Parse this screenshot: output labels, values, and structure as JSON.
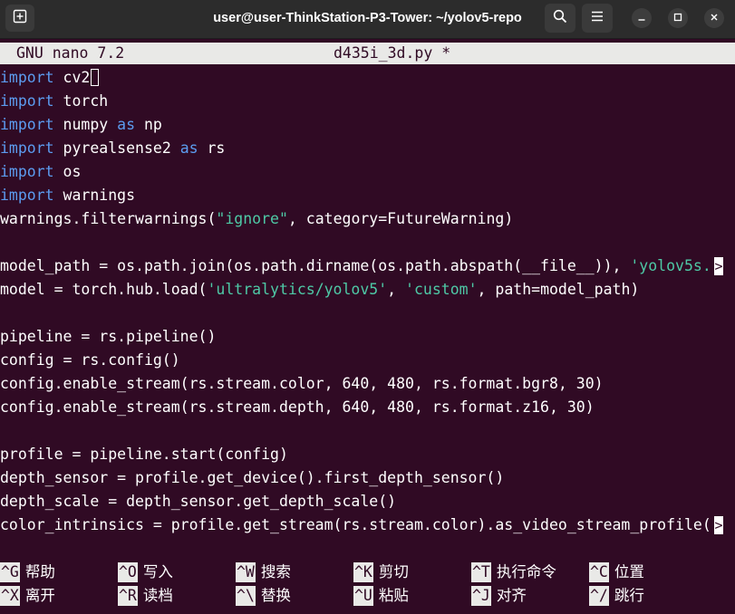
{
  "window": {
    "title": "user@user-ThinkStation-P3-Tower: ~/yolov5-repo"
  },
  "icons": {
    "new_tab": "new-tab-icon",
    "search": "search-icon",
    "menu": "hamburger-menu-icon",
    "minimize": "minimize-icon",
    "maximize": "maximize-icon",
    "close": "close-icon"
  },
  "colors": {
    "terminal_bg": "#300a24",
    "keyword": "#5c9cf0",
    "string": "#4ec9a6",
    "header_bg": "#e9e9e7"
  },
  "nano": {
    "version": "GNU nano 7.2",
    "filename": "d435i_3d.py *"
  },
  "code": {
    "l1": {
      "kw": "import",
      "rest": " cv2"
    },
    "l2": {
      "kw": "import",
      "rest": " torch"
    },
    "l3": {
      "kw1": "import",
      "a": " numpy ",
      "kw2": "as",
      "b": " np"
    },
    "l4": {
      "kw1": "import",
      "a": " pyrealsense2 ",
      "kw2": "as",
      "b": " rs"
    },
    "l5": {
      "kw": "import",
      "rest": " os"
    },
    "l6": {
      "kw": "import",
      "rest": " warnings"
    },
    "l7": {
      "a": "warnings.filterwarnings(",
      "s1": "\"ignore\"",
      "b": ", category=FutureWarning)"
    },
    "l9": {
      "a": "model_path = os.path.join(os.path.dirname(os.path.abspath(__file__)), ",
      "s1": "'yolov5s.",
      "marker": ">"
    },
    "l10": {
      "a": "model = torch.hub.load(",
      "s1": "'ultralytics/yolov5'",
      "b": ", ",
      "s2": "'custom'",
      "c": ", path=model_path)"
    },
    "l12": "pipeline = rs.pipeline()",
    "l13": "config = rs.config()",
    "l14": "config.enable_stream(rs.stream.color, 640, 480, rs.format.bgr8, 30)",
    "l15": "config.enable_stream(rs.stream.depth, 640, 480, rs.format.z16, 30)",
    "l17": "profile = pipeline.start(config)",
    "l18": "depth_sensor = profile.get_device().first_depth_sensor()",
    "l19": "depth_scale = depth_sensor.get_depth_scale()",
    "l20": {
      "a": "color_intrinsics = profile.get_stream(rs.stream.color).as_video_stream_profile(",
      "marker": ">"
    }
  },
  "shortcuts": [
    {
      "key": "^G",
      "label": "帮助"
    },
    {
      "key": "^O",
      "label": "写入"
    },
    {
      "key": "^W",
      "label": "搜索"
    },
    {
      "key": "^K",
      "label": "剪切"
    },
    {
      "key": "^T",
      "label": "执行命令"
    },
    {
      "key": "^C",
      "label": "位置"
    },
    {
      "key": "^X",
      "label": "离开"
    },
    {
      "key": "^R",
      "label": "读档"
    },
    {
      "key": "^\\",
      "label": "替换"
    },
    {
      "key": "^U",
      "label": "粘贴"
    },
    {
      "key": "^J",
      "label": "对齐"
    },
    {
      "key": "^/",
      "label": "跳行"
    }
  ]
}
